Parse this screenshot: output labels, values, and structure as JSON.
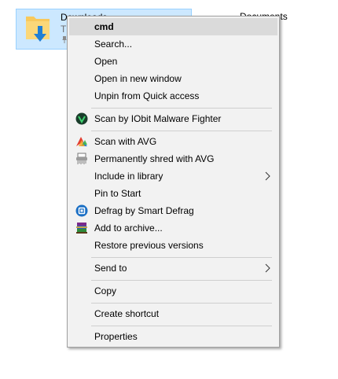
{
  "background": {
    "selected_tile": {
      "title": "Downloads",
      "subtitle": "This PC"
    },
    "documents_label": "Documents"
  },
  "menu": {
    "items": [
      {
        "label": "cmd",
        "bold": true,
        "highlighted": true
      },
      {
        "label": "Search..."
      },
      {
        "label": "Open"
      },
      {
        "label": "Open in new window"
      },
      {
        "label": "Unpin from Quick access"
      },
      {
        "label": "Scan by IObit Malware Fighter",
        "icon": "iobit-malware-fighter-icon"
      },
      {
        "label": "Scan with AVG",
        "icon": "avg-icon"
      },
      {
        "label": "Permanently shred with AVG",
        "icon": "shredder-icon"
      },
      {
        "label": "Include in library",
        "submenu": true
      },
      {
        "label": "Pin to Start"
      },
      {
        "label": "Defrag by Smart Defrag",
        "icon": "smart-defrag-icon"
      },
      {
        "label": "Add to archive...",
        "icon": "winrar-icon"
      },
      {
        "label": "Restore previous versions"
      },
      {
        "label": "Send to",
        "submenu": true
      },
      {
        "label": "Copy"
      },
      {
        "label": "Create shortcut"
      },
      {
        "label": "Properties"
      }
    ]
  },
  "colors": {
    "selection_tile": "#cce8ff",
    "menu_background": "#f2f2f2",
    "menu_highlight": "#dadada",
    "folder_yellow": "#f8c95c",
    "download_arrow_blue": "#1f7fd6"
  }
}
